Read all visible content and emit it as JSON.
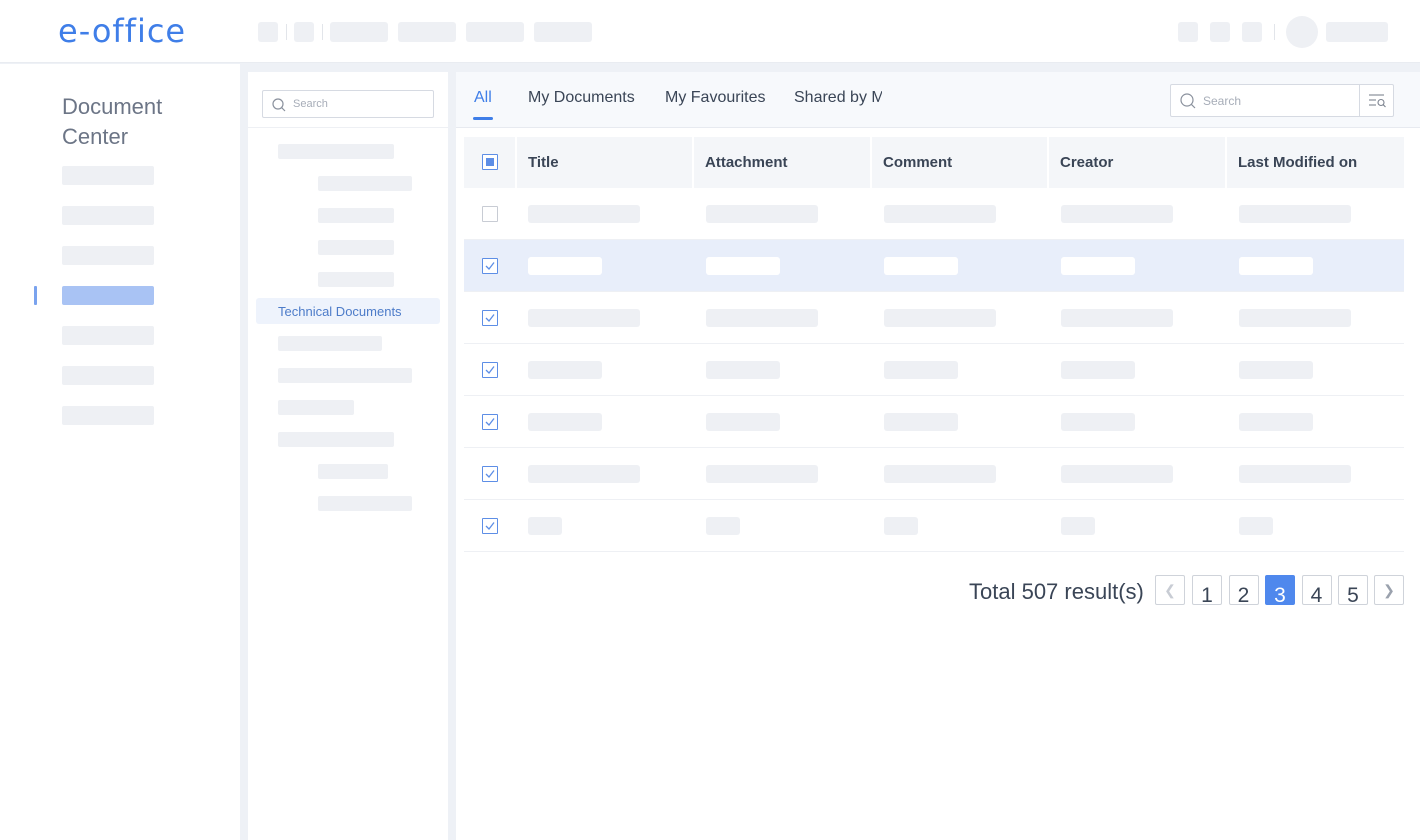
{
  "header": {
    "logo_text": "e-office"
  },
  "leftnav": {
    "title": "Document Center"
  },
  "tree": {
    "search_placeholder": "Search",
    "selected_label": "Technical Documents"
  },
  "tabs": [
    {
      "label": "All",
      "active": true
    },
    {
      "label": "My Documents"
    },
    {
      "label": "My Favourites"
    },
    {
      "label": "Shared by Me"
    }
  ],
  "main_search": {
    "placeholder": "Search"
  },
  "table": {
    "columns": [
      "Title",
      "Attachment",
      "Comment",
      "Creator",
      "Last Modified on"
    ],
    "rows": [
      {
        "checked": false,
        "selected": false
      },
      {
        "checked": true,
        "selected": true
      },
      {
        "checked": true,
        "selected": false
      },
      {
        "checked": true,
        "selected": false
      },
      {
        "checked": true,
        "selected": false
      },
      {
        "checked": true,
        "selected": false
      },
      {
        "checked": true,
        "selected": false
      }
    ]
  },
  "pagination": {
    "total_text": "Total 507 result(s)",
    "pages": [
      "1",
      "2",
      "3",
      "4",
      "5"
    ],
    "current_page": "3"
  },
  "colors": {
    "accent": "#3f7ee8",
    "selected_row": "#e8eefa",
    "placeholder": "#eef0f4"
  }
}
